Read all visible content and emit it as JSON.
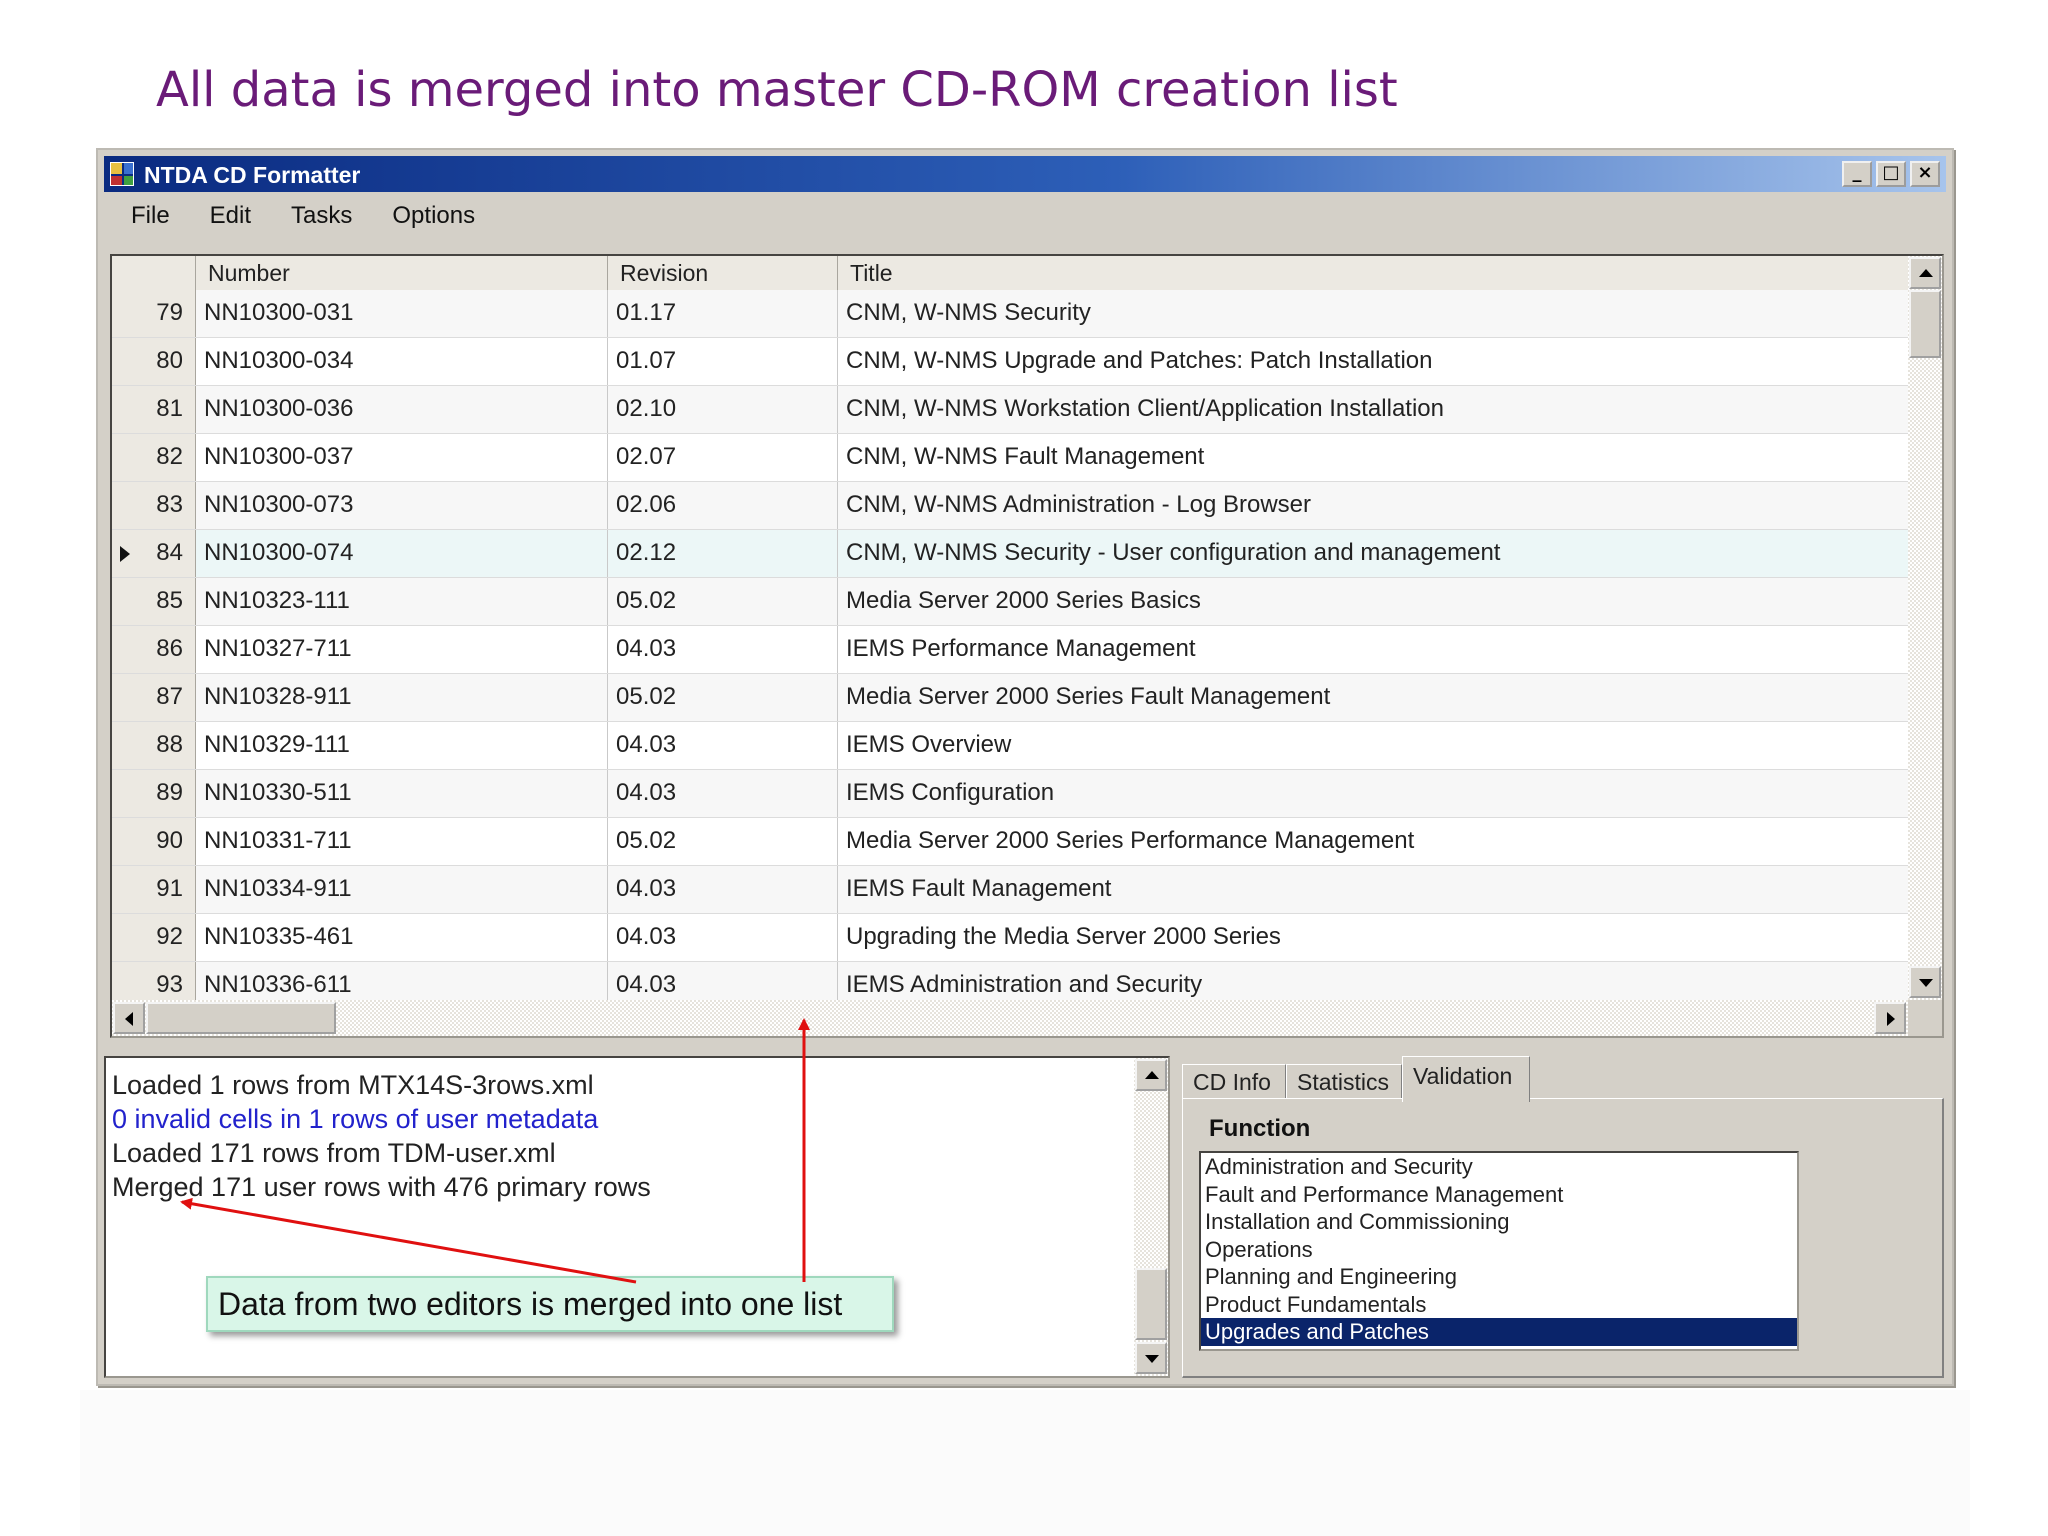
{
  "slide": {
    "title": "All data is merged into master CD-ROM creation list"
  },
  "window": {
    "title": "NTDA CD Formatter",
    "caption_buttons": [
      "_",
      "□",
      "×"
    ]
  },
  "menu": [
    "File",
    "Edit",
    "Tasks",
    "Options"
  ],
  "grid": {
    "columns": [
      "Number",
      "Revision",
      "Title"
    ],
    "current_row": 84,
    "rows": [
      {
        "id": "79",
        "number": "NN10300-031",
        "revision": "01.17",
        "title": "CNM, W-NMS Security"
      },
      {
        "id": "80",
        "number": "NN10300-034",
        "revision": "01.07",
        "title": "CNM, W-NMS Upgrade and Patches:  Patch Installation"
      },
      {
        "id": "81",
        "number": "NN10300-036",
        "revision": "02.10",
        "title": "CNM, W-NMS Workstation Client/Application Installation"
      },
      {
        "id": "82",
        "number": "NN10300-037",
        "revision": "02.07",
        "title": "CNM, W-NMS Fault Management"
      },
      {
        "id": "83",
        "number": "NN10300-073",
        "revision": "02.06",
        "title": "CNM, W-NMS Administration - Log Browser"
      },
      {
        "id": "84",
        "number": "NN10300-074",
        "revision": "02.12",
        "title": "CNM, W-NMS  Security - User configuration and management"
      },
      {
        "id": "85",
        "number": "NN10323-111",
        "revision": "05.02",
        "title": "Media Server 2000 Series Basics"
      },
      {
        "id": "86",
        "number": "NN10327-711",
        "revision": "04.03",
        "title": "IEMS Performance Management"
      },
      {
        "id": "87",
        "number": "NN10328-911",
        "revision": "05.02",
        "title": "Media Server 2000 Series Fault Management"
      },
      {
        "id": "88",
        "number": "NN10329-111",
        "revision": "04.03",
        "title": "IEMS Overview"
      },
      {
        "id": "89",
        "number": "NN10330-511",
        "revision": "04.03",
        "title": "IEMS Configuration"
      },
      {
        "id": "90",
        "number": "NN10331-711",
        "revision": "05.02",
        "title": "Media Server 2000 Series Performance Management"
      },
      {
        "id": "91",
        "number": "NN10334-911",
        "revision": "04.03",
        "title": "IEMS Fault Management"
      },
      {
        "id": "92",
        "number": "NN10335-461",
        "revision": "04.03",
        "title": "Upgrading the Media Server 2000 Series"
      },
      {
        "id": "93",
        "number": "NN10336-611",
        "revision": "04.03",
        "title": "IEMS Administration and Security"
      }
    ]
  },
  "log": {
    "lines": [
      "Loaded 1 rows from MTX14S-3rows.xml",
      "0 invalid cells in 1 rows of user metadata",
      "Loaded 171 rows from TDM-user.xml",
      "Merged 171 user rows with 476 primary rows"
    ]
  },
  "tabs": {
    "items": [
      "CD Info",
      "Statistics",
      "Validation"
    ],
    "active": "Validation",
    "function_label": "Function",
    "function_options": [
      "Administration and Security",
      "Fault and Performance Management",
      "Installation and Commissioning",
      "Operations",
      "Planning and Engineering",
      "Product Fundamentals",
      "Upgrades and Patches"
    ],
    "selected_option": "Upgrades and Patches"
  },
  "annotation": {
    "callout": "Data from two editors is merged into one list"
  },
  "colors": {
    "title": "#6a1b78",
    "arrow": "#e01010",
    "selection": "#0a246a",
    "log_highlight": "#2222cc",
    "callout_bg": "#d9f6e8"
  }
}
